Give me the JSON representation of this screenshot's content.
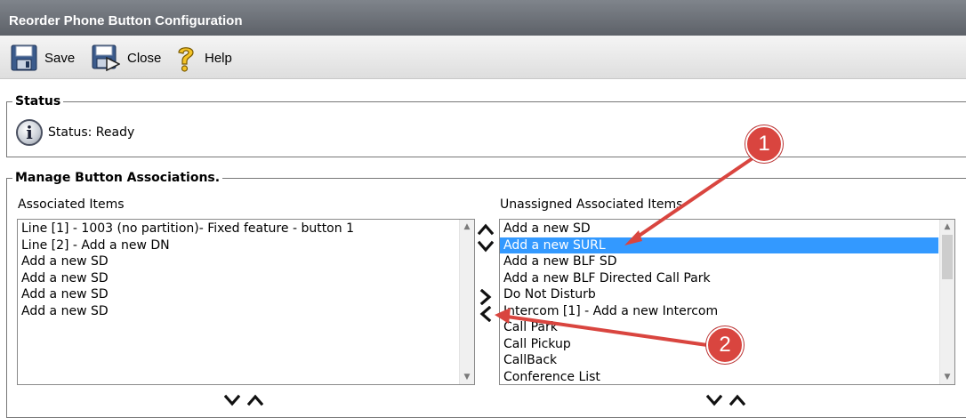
{
  "window": {
    "title": "Reorder Phone Button Configuration"
  },
  "toolbar": {
    "save_label": "Save",
    "close_label": "Close",
    "help_label": "Help"
  },
  "status": {
    "legend": "Status",
    "text": "Status: Ready"
  },
  "manage": {
    "legend": "Manage Button Associations.",
    "associated_label": "Associated Items",
    "unassigned_label": "Unassigned Associated Items",
    "associated_items": [
      "Line [1] - 1003 (no partition)- Fixed feature - button 1",
      "Line [2] - Add a new DN",
      "Add a new SD",
      "Add a new SD",
      "Add a new SD",
      "Add a new SD"
    ],
    "unassigned_items": [
      "Add a new SD",
      "Add a new SURL",
      "Add a new BLF SD",
      "Add a new BLF Directed Call Park",
      "Do Not Disturb",
      "Intercom [1] - Add a new Intercom",
      "Call Park",
      "Call Pickup",
      "CallBack",
      "Conference List"
    ],
    "selected_unassigned": "Add a new SURL"
  },
  "annotations": {
    "callout_1": "1",
    "callout_2": "2"
  },
  "colors": {
    "titlebar": "#6e737a",
    "selection": "#3399ff",
    "callout": "#d9453f"
  }
}
